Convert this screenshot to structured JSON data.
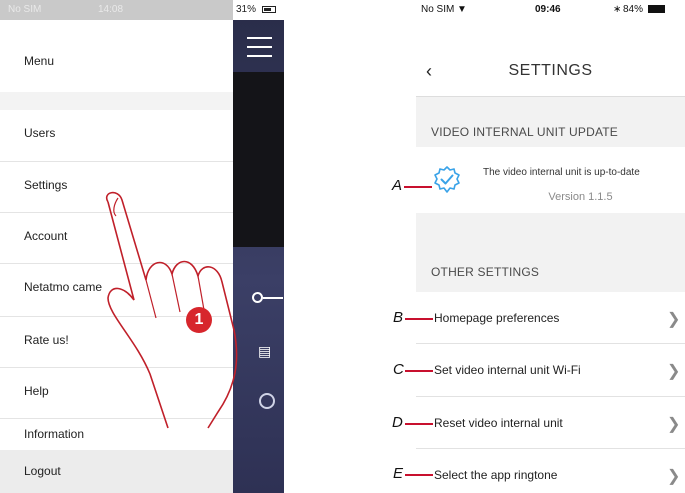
{
  "left_phone": {
    "status_bar": {
      "carrier": "No SIM",
      "time": "14:08",
      "battery": "31%"
    },
    "menu": {
      "header": "Menu",
      "items": [
        {
          "label": "Users"
        },
        {
          "label": "Settings"
        },
        {
          "label": "Account"
        },
        {
          "label": "Netatmo came"
        },
        {
          "label": "Rate us!"
        },
        {
          "label": "Help"
        },
        {
          "label": "Information"
        },
        {
          "label": "Logout"
        }
      ]
    },
    "step_badge": "1"
  },
  "right_phone": {
    "status_bar": {
      "carrier": "No SIM",
      "time": "09:46",
      "battery": "84%"
    },
    "title": "SETTINGS",
    "sections": [
      {
        "header": "VIDEO INTERNAL UNIT UPDATE",
        "status_text": "The video internal unit is up-to-date",
        "version": "Version 1.1.5"
      },
      {
        "header": "OTHER SETTINGS",
        "rows": [
          {
            "label": "Homepage preferences"
          },
          {
            "label": "Set video internal unit Wi-Fi"
          },
          {
            "label": "Reset video internal unit"
          },
          {
            "label": "Select the app ringtone"
          }
        ]
      }
    ]
  },
  "annotations": {
    "letters": [
      "A",
      "B",
      "C",
      "D",
      "E"
    ],
    "accent_color": "#c8102e"
  },
  "icons": [
    "hamburger-icon",
    "key-icon",
    "gate-icon",
    "light-icon",
    "hand-pointer-icon",
    "update-check-icon",
    "back-chevron-icon",
    "chevron-right-icon",
    "wifi-icon",
    "bluetooth-icon",
    "battery-icon"
  ]
}
